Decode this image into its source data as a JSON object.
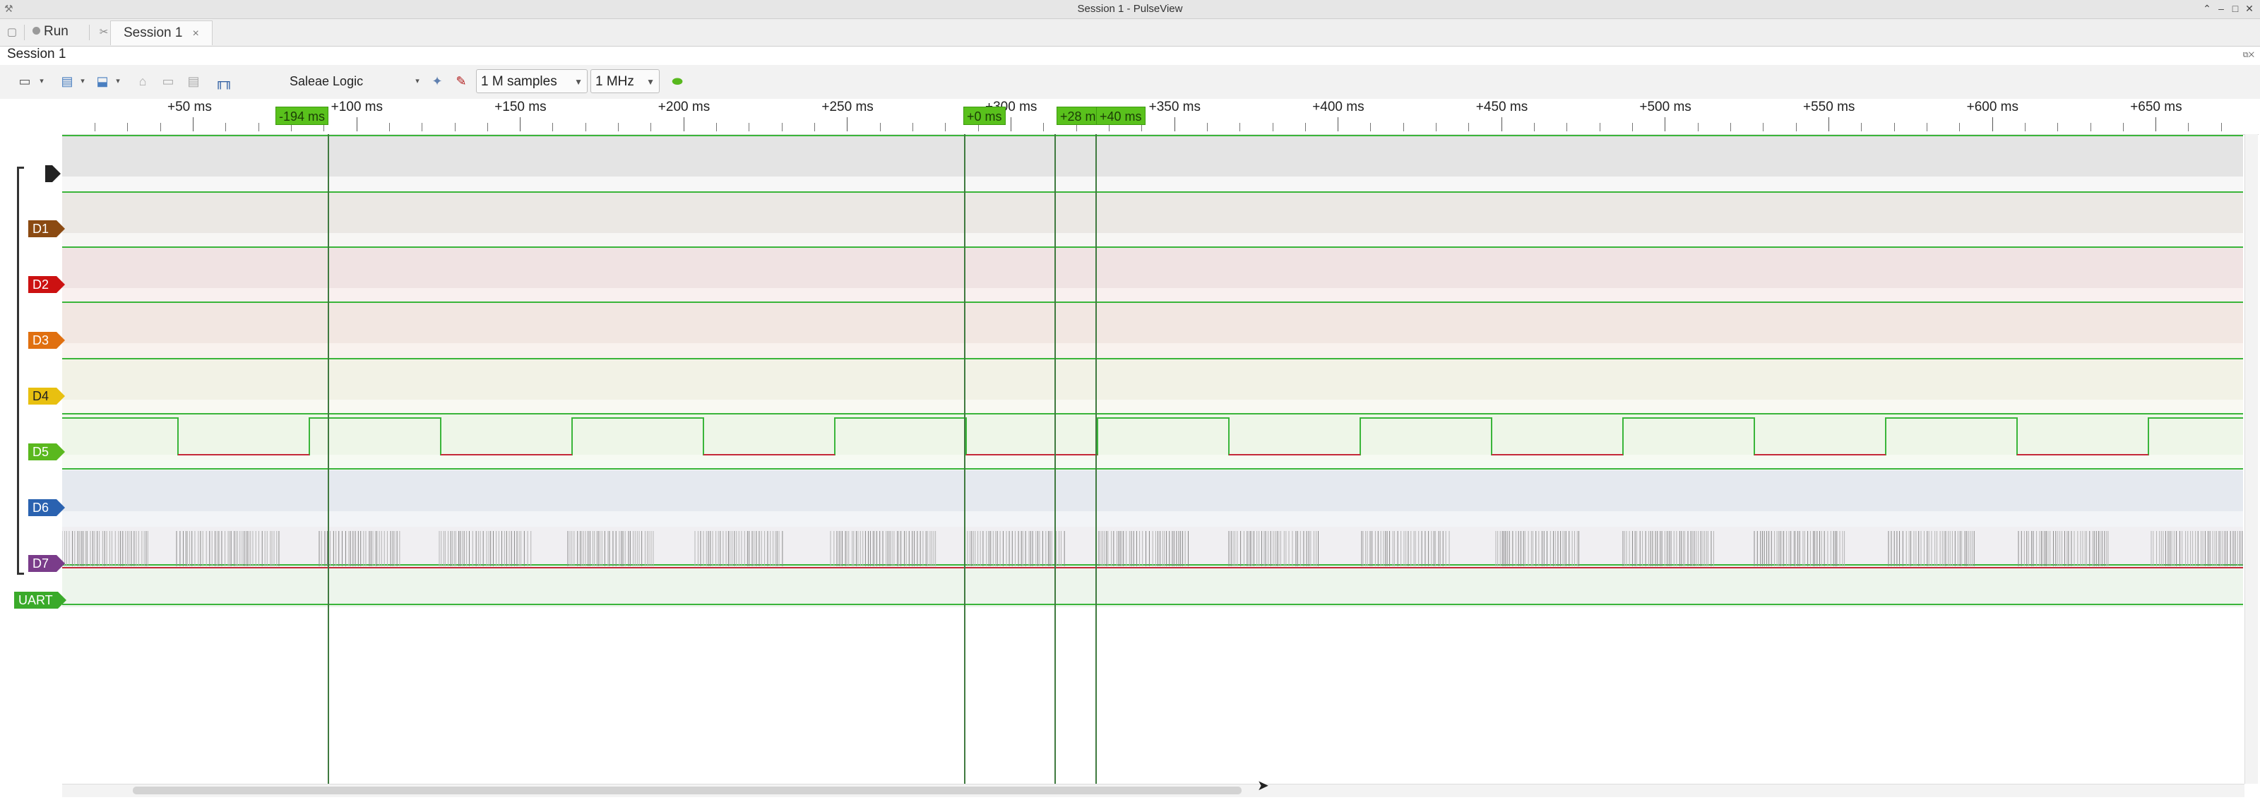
{
  "window": {
    "title": "Session 1 - PulseView"
  },
  "tabbar": {
    "run_label": "Run",
    "session_tab": "Session 1",
    "close_glyph": "×"
  },
  "session": {
    "label": "Session 1"
  },
  "toolbar": {
    "device": "Saleae Logic",
    "samples": "1 M samples",
    "rate": "1 MHz"
  },
  "ruler": {
    "ticks": [
      "+50 ms",
      "+100 ms",
      "+150 ms",
      "+200 ms",
      "+250 ms",
      "+300 ms",
      "+350 ms",
      "+400 ms",
      "+450 ms",
      "+500 ms",
      "+550 ms",
      "+600 ms",
      "+650 ms"
    ],
    "flags": [
      "-194 ms",
      "+0 ms",
      "+28 m",
      "+40 ms"
    ]
  },
  "channels": [
    {
      "name": "",
      "color": "#222222"
    },
    {
      "name": "D1",
      "color": "#8b4a12"
    },
    {
      "name": "D2",
      "color": "#cc1111"
    },
    {
      "name": "D3",
      "color": "#e07010"
    },
    {
      "name": "D4",
      "color": "#e8c010"
    },
    {
      "name": "D5",
      "color": "#5ab81e"
    },
    {
      "name": "D6",
      "color": "#2a62b0"
    },
    {
      "name": "D7",
      "color": "#7a3c8a"
    },
    {
      "name": "UART",
      "color": "#3aaa2a"
    }
  ],
  "colors": {
    "accent_flag": "#59c11c",
    "trace_line": "#3ab53a"
  }
}
